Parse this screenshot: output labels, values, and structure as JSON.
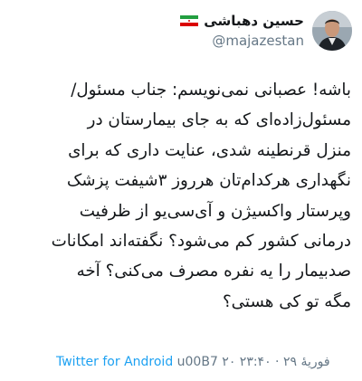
{
  "tweet": {
    "author_name": "حسین دهباشی",
    "handle": "@majazestan",
    "lines": [
      "باشه! عصبانی نمی‌نویسم: جناب مسئول/",
      "مسئول‌زاده‌ای که به جای بیمارستان در",
      "منزل قرنطینه شدی، عنایت داری که برای",
      "نگهداری هرکدام‌تان هرروز ۳شیفت پزشک",
      "وپرستار واکسیژن و آی‌سی‌یو از ظرفیت",
      "درمانی کشور کم می‌شود؟ نگفته‌اند امکانات",
      "صدبیمار را یه نفره مصرف می‌کنی؟ آخه",
      "مگه تو کی هستی؟"
    ],
    "source": "Twitter for Android",
    "timestamp": "u00B7 ۲۰ فوریهٔ ۲۹ · ۲۳:۴۰"
  },
  "icons": {
    "avatar": "profile-avatar",
    "flag": "iran-flag-icon"
  },
  "colors": {
    "handle": "#657786",
    "source": "#1da1f2",
    "text": "#14171a"
  }
}
